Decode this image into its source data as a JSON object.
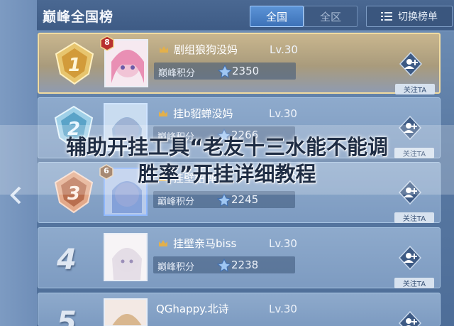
{
  "header": {
    "title": "巅峰全国榜",
    "tabs": [
      {
        "label": "全国",
        "active": true
      },
      {
        "label": "全区",
        "active": false
      }
    ],
    "switch_label": "切换榜单"
  },
  "rows": [
    {
      "rank": "1",
      "level_badge": "8",
      "name": "剧组狼狗没妈",
      "level": "Lv.30",
      "score_label": "巅峰积分",
      "score": "2350",
      "follow": "关注TA"
    },
    {
      "rank": "2",
      "name": "挂b貂蝉没妈",
      "level": "Lv.30",
      "score_label": "巅峰积分",
      "score": "2266",
      "follow": "关注TA"
    },
    {
      "rank": "3",
      "level_badge": "6",
      "name": "挂壁貂蝉",
      "level": "Lv.30",
      "score_label": "巅峰积分",
      "score": "2245",
      "follow": "关注TA"
    },
    {
      "rank": "4",
      "name": "挂壁亲马biss",
      "level": "Lv.30",
      "score_label": "巅峰积分",
      "score": "2238",
      "follow": "关注TA"
    },
    {
      "rank": "5",
      "name": "QGhappy.北诗",
      "level": "Lv.30",
      "score_label": "",
      "score": "",
      "follow": ""
    }
  ],
  "overlay": {
    "line1": "辅助开挂工具“老友十三水能不能调",
    "line2": "胜率”开挂详细教程"
  },
  "colors": {
    "tab_active": "#4a84c8",
    "overlay_text": "#1f2d44",
    "gold_border": "#f2dca0"
  }
}
